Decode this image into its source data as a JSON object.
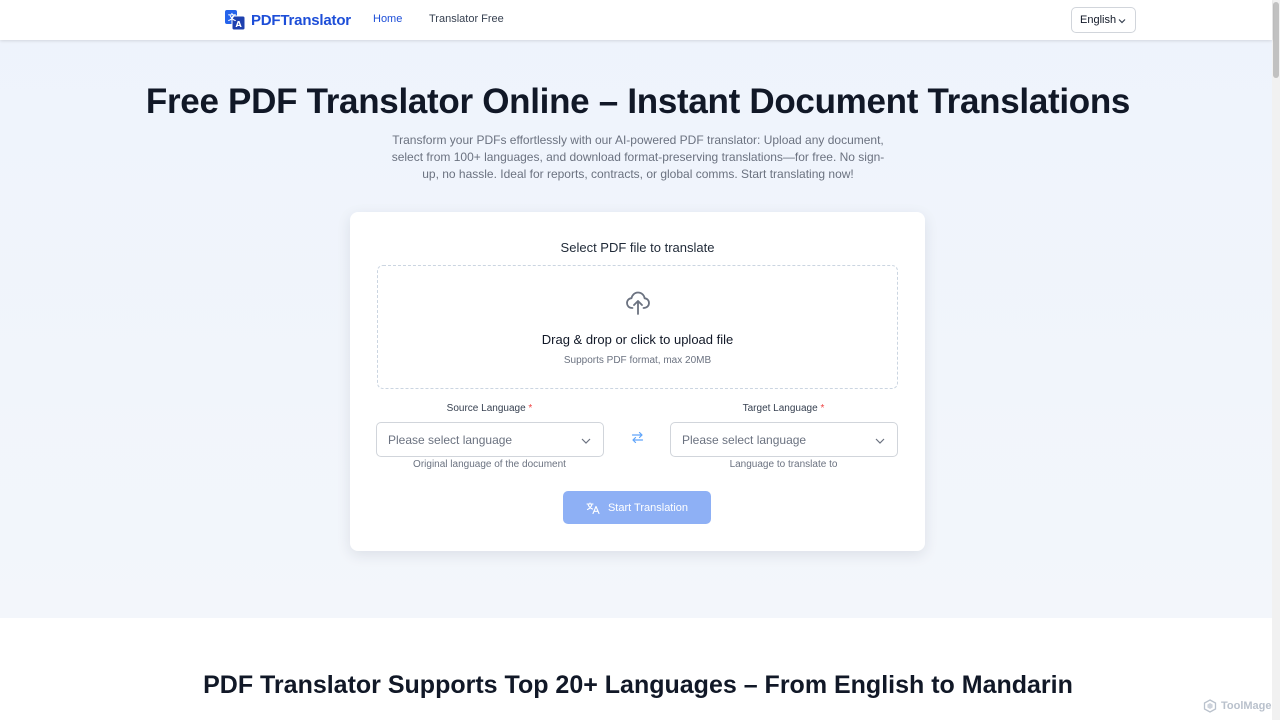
{
  "nav": {
    "logo_text": "PDFTranslator",
    "links": [
      {
        "label": "Home",
        "active": true
      },
      {
        "label": "Translator Free",
        "active": false
      }
    ],
    "language_selector": "English"
  },
  "hero": {
    "title": "Free PDF Translator Online – Instant Document Translations",
    "description": "Transform your PDFs effortlessly with our AI-powered PDF translator: Upload any document, select from 100+ languages, and download format-preserving translations—for free. No sign-up, no hassle. Ideal for reports, contracts, or global comms. Start translating now!"
  },
  "upload_card": {
    "title": "Select PDF file to translate",
    "dropzone_text": "Drag & drop or click to upload file",
    "dropzone_subtext": "Supports PDF format, max 20MB",
    "source": {
      "label": "Source Language",
      "required_mark": "*",
      "placeholder": "Please select language",
      "helper": "Original language of the document"
    },
    "target": {
      "label": "Target Language",
      "required_mark": "*",
      "placeholder": "Please select language",
      "helper": "Language to translate to"
    },
    "start_button": "Start Translation"
  },
  "section2": {
    "title": "PDF Translator Supports Top 20+ Languages – From English to Mandarin"
  },
  "watermark": "ToolMage",
  "colors": {
    "brand": "#1d4ed8",
    "button_disabled": "#8eb0f5",
    "required": "#ef4444"
  },
  "icons": [
    "logo-icon",
    "chevron-down-icon",
    "cloud-upload-icon",
    "swap-arrows-icon",
    "translate-icon",
    "toolmage-logo-icon"
  ]
}
